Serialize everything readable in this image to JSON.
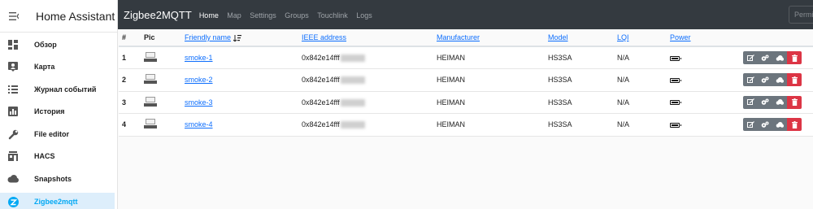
{
  "sidebar": {
    "title": "Home Assistant",
    "items": [
      {
        "label": "Обзор",
        "icon": "dashboard-icon"
      },
      {
        "label": "Карта",
        "icon": "map-icon"
      },
      {
        "label": "Журнал событий",
        "icon": "logbook-icon"
      },
      {
        "label": "История",
        "icon": "history-icon"
      },
      {
        "label": "File editor",
        "icon": "wrench-icon"
      },
      {
        "label": "HACS",
        "icon": "hacs-icon"
      },
      {
        "label": "Snapshots",
        "icon": "cloud-icon"
      },
      {
        "label": "Zigbee2mqtt",
        "icon": "zigbee-icon",
        "active": true
      }
    ]
  },
  "topbar": {
    "brand": "Zigbee2MQTT",
    "nav": [
      "Home",
      "Map",
      "Settings",
      "Groups",
      "Touchlink",
      "Logs"
    ],
    "active": "Home",
    "permit_label": "Permit join"
  },
  "table": {
    "headers": {
      "num": "#",
      "pic": "Pic",
      "friendly_name": "Friendly name",
      "ieee": "IEEE address",
      "manufacturer": "Manufacturer",
      "model": "Model",
      "lqi": "LQI",
      "power": "Power"
    },
    "rows": [
      {
        "num": "1",
        "friendly_name": "smoke-1",
        "ieee": "0x842e14fff",
        "manufacturer": "HEIMAN",
        "model": "HS3SA",
        "lqi": "N/A"
      },
      {
        "num": "2",
        "friendly_name": "smoke-2",
        "ieee": "0x842e14fff",
        "manufacturer": "HEIMAN",
        "model": "HS3SA",
        "lqi": "N/A"
      },
      {
        "num": "3",
        "friendly_name": "smoke-3",
        "ieee": "0x842e14fff",
        "manufacturer": "HEIMAN",
        "model": "HS3SA",
        "lqi": "N/A"
      },
      {
        "num": "4",
        "friendly_name": "smoke-4",
        "ieee": "0x842e14fff",
        "manufacturer": "HEIMAN",
        "model": "HS3SA",
        "lqi": "N/A"
      }
    ]
  },
  "colors": {
    "topbar": "#343a40",
    "link": "#0d6efd",
    "accent": "#03a9f4",
    "button_gray": "#6c757d",
    "button_red": "#dc3545"
  }
}
